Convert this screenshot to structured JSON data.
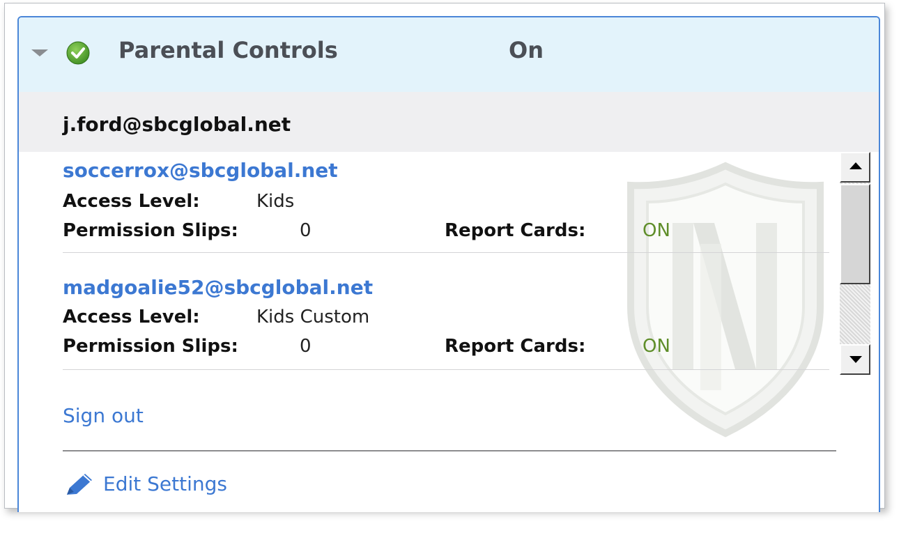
{
  "header": {
    "title": "Parental Controls",
    "status": "On"
  },
  "account": {
    "email": "j.ford@sbcglobal.net"
  },
  "children": [
    {
      "email": "soccerrox@sbcglobal.net",
      "access_level_label": "Access Level:",
      "access_level": "Kids",
      "permission_slips_label": "Permission Slips:",
      "permission_slips": "0",
      "report_cards_label": "Report Cards:",
      "report_cards": "ON"
    },
    {
      "email": "madgoalie52@sbcglobal.net",
      "access_level_label": "Access Level:",
      "access_level": "Kids Custom",
      "permission_slips_label": "Permission Slips:",
      "permission_slips": "0",
      "report_cards_label": "Report Cards:",
      "report_cards": "ON"
    }
  ],
  "actions": {
    "sign_out": "Sign out",
    "edit_settings": "Edit Settings"
  },
  "icons": {
    "expand": "chevron-down-icon",
    "status": "check-circle-icon",
    "watermark": "shield-logo",
    "edit": "pencil-icon"
  },
  "colors": {
    "link": "#3c78d2",
    "header_bg": "#e3f3fb",
    "panel_border": "#4a86d8",
    "status_on": "#5f8e2a",
    "check_green": "#5aa832"
  }
}
